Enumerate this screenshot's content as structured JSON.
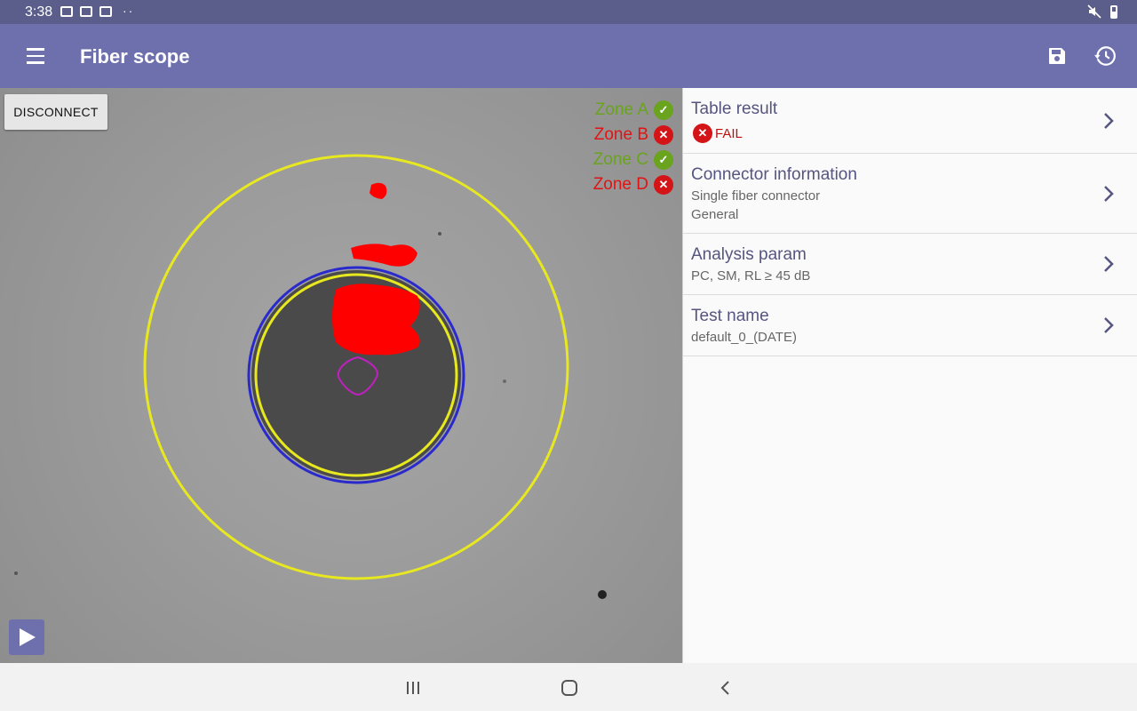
{
  "status_bar": {
    "time": "3:38",
    "left_icons": [
      "image-icon",
      "notification-icon",
      "notification-icon"
    ],
    "more": "··",
    "right_icons": [
      "mute-icon",
      "battery-icon"
    ]
  },
  "app_bar": {
    "title": "Fiber scope",
    "actions": [
      "save-icon",
      "history-icon"
    ]
  },
  "scope": {
    "disconnect_label": "DISCONNECT",
    "zones": [
      {
        "label": "Zone A",
        "status": "pass",
        "color": "#6aa31e"
      },
      {
        "label": "Zone B",
        "status": "fail",
        "color": "#e01414"
      },
      {
        "label": "Zone C",
        "status": "pass",
        "color": "#6aa31e"
      },
      {
        "label": "Zone D",
        "status": "fail",
        "color": "#e01414"
      }
    ],
    "ring_colors": {
      "zone_outer": "#e8e820",
      "cladding": "#2a2acc",
      "core": "#c020c0",
      "defect": "#ff0000"
    }
  },
  "panel": {
    "table_result": {
      "title": "Table result",
      "status": "FAIL"
    },
    "connector": {
      "title": "Connector information",
      "line1": "Single fiber connector",
      "line2": "General"
    },
    "analysis": {
      "title": "Analysis param",
      "line1": "PC, SM, RL ≥ 45 dB"
    },
    "test_name": {
      "title": "Test name",
      "line1": "default_0_(DATE)"
    }
  },
  "colors": {
    "app_bar": "#6e70ae",
    "status_bar": "#5b5d8a",
    "pass": "#6aa31e",
    "fail": "#e01414"
  }
}
